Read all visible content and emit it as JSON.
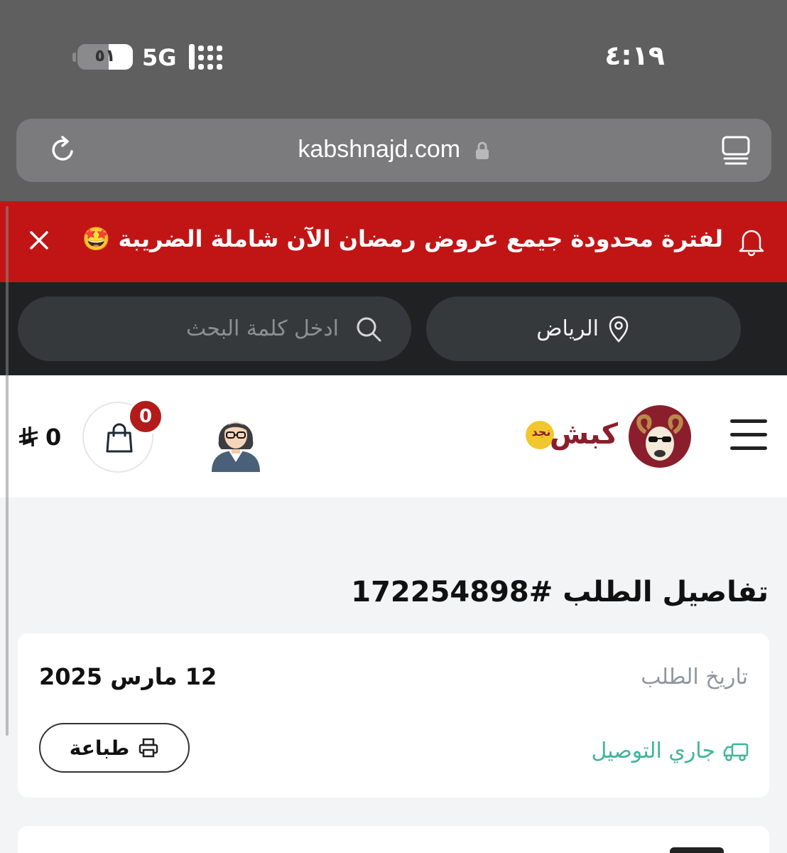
{
  "status_bar": {
    "time": "٤:١٩",
    "network": "5G",
    "battery": "٥١"
  },
  "browser": {
    "url": "kabshnajd.com"
  },
  "promo": {
    "text": "لفترة محدودة جيمع عروض رمضان الآن شاملة الضريبة 🤩"
  },
  "search_bar": {
    "location": "الرياض",
    "search_placeholder": "ادخل كلمة البحث"
  },
  "header": {
    "logo_text": "كبش",
    "logo_badge": "نجد",
    "cart_count": "0",
    "cart_total": "0"
  },
  "order": {
    "title": "تفاصيل الطلب #172254898",
    "date_label": "تاريخ الطلب",
    "date_value": "12 مارس 2025",
    "status": "جاري التوصيل",
    "print_label": "طباعة"
  },
  "colors": {
    "promo_bg": "#c11515",
    "brand": "#8b1e2c",
    "status_green": "#3fb59a",
    "badge_red": "#b31b1b"
  }
}
